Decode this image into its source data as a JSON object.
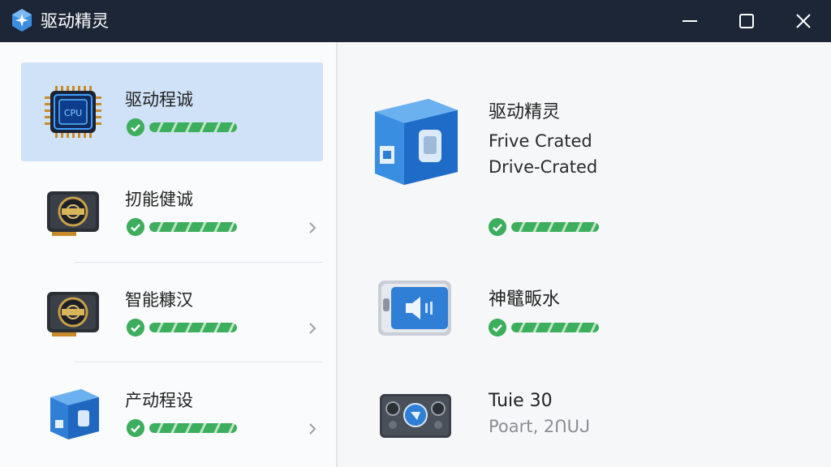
{
  "window": {
    "title": "驱动精灵"
  },
  "titlebar": {
    "minimize_icon": "minimize-icon",
    "maximize_icon": "maximize-icon",
    "close_icon": "close-icon"
  },
  "drivers": [
    {
      "label": "驱动程诚",
      "icon": "cpu-chip-icon",
      "status": "ok",
      "progress": 1.0,
      "selected": true
    },
    {
      "label": "扨能健诚",
      "icon": "graphics-card-icon",
      "status": "ok",
      "progress": 1.0,
      "selected": false
    },
    {
      "label": "智能糠汉",
      "icon": "graphics-card-icon",
      "status": "ok",
      "progress": 1.0,
      "selected": false
    },
    {
      "label": "产动程设",
      "icon": "driver-box-icon",
      "status": "ok",
      "progress": 1.0,
      "selected": false
    }
  ],
  "detail": {
    "product": {
      "title": "驱动精灵",
      "line1": "Frive Crated",
      "line2": "Drive-Crated",
      "icon": "driver-box-icon",
      "progress": 1.0
    },
    "audio": {
      "title": "神鼊畈水",
      "icon": "audio-device-icon",
      "progress": 1.0
    },
    "system": {
      "title": "Tuie 30",
      "subtitle": "Poart‚ 2ᑎᑌᒍ",
      "icon": "system-board-icon"
    }
  },
  "colors": {
    "titlebar": "#1d2636",
    "selected_row": "#cfe2f8",
    "success": "#3cae5d",
    "accent": "#2f7fd6"
  }
}
